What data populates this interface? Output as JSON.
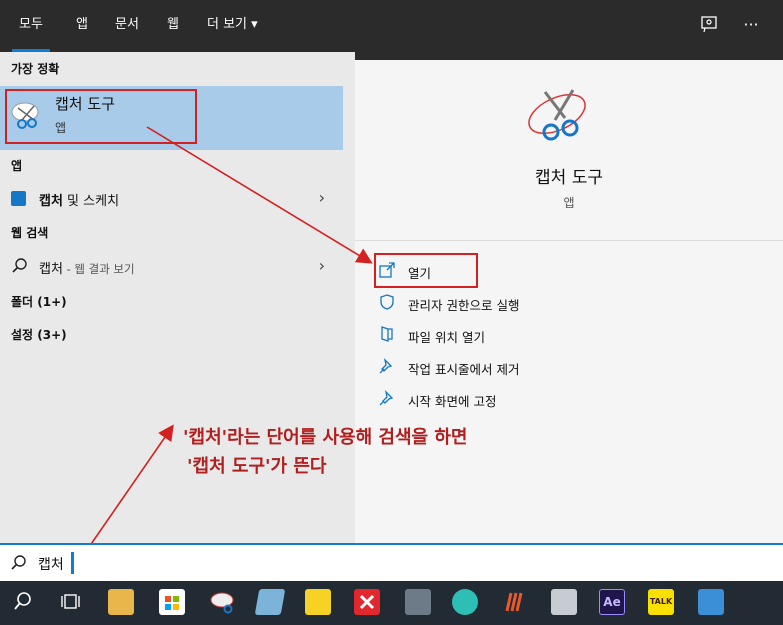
{
  "tabs": [
    "모두",
    "앱",
    "문서",
    "웹",
    "더 보기 ▾"
  ],
  "top_icons": {
    "feedback": "feedback-icon",
    "more": "···"
  },
  "left": {
    "best_match_header": "가장 정확",
    "best_match": {
      "title": "캡처 도구",
      "subtitle": "앱"
    },
    "apps_header": "앱",
    "apps": [
      {
        "label_bold": "캡처",
        "label_rest": " 및 스케치"
      }
    ],
    "web_header": "웹 검색",
    "web": {
      "query": "캡처",
      "suffix": " - 웹 결과 보기"
    },
    "folders": "폴더 (1+)",
    "settings": "설정 (3+)"
  },
  "right": {
    "app_name": "캡처 도구",
    "app_type": "앱",
    "actions": [
      "열기",
      "관리자 권한으로 실행",
      "파일 위치 열기",
      "작업 표시줄에서 제거",
      "시작 화면에 고정"
    ]
  },
  "annotation": {
    "line1": "'캡처'라는 단어를 사용해 검색을 하면",
    "line2": "'캡처 도구'가 뜬다"
  },
  "search": {
    "value": "캡처"
  },
  "taskbar": {
    "icons": [
      "search-icon",
      "task-view-icon",
      "file-explorer-icon",
      "store-icon",
      "snipping-tool-icon",
      "notepad-icon",
      "sticky-notes-icon",
      "xmind-icon",
      "calculator-icon",
      "fish-app-icon",
      "stripes-app-icon",
      "scanner-icon",
      "after-effects-icon",
      "kakaotalk-icon",
      "control-panel-icon"
    ],
    "ae_label": "Ae",
    "talk_label": "TALK"
  },
  "colors": {
    "accent": "#0f7dd6",
    "highlight": "#a8cbe9",
    "annotation": "#b11e1e"
  }
}
